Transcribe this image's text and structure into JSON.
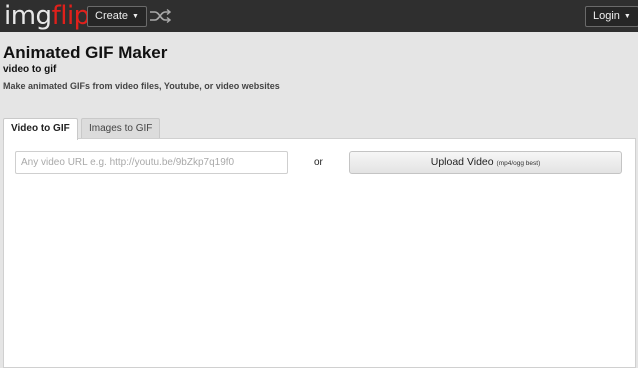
{
  "header": {
    "logo_part1": "img",
    "logo_part2": "flip",
    "create_label": "Create",
    "login_label": "Login",
    "caret": "▼"
  },
  "page": {
    "title": "Animated GIF Maker",
    "subtitle": "video to gif",
    "description": "Make animated GIFs from video files, Youtube, or video websites"
  },
  "tabs": [
    {
      "label": "Video to GIF",
      "active": true
    },
    {
      "label": "Images to GIF",
      "active": false
    }
  ],
  "video": {
    "url_placeholder": "Any video URL e.g. http://youtu.be/9bZkp7q19f0",
    "url_value": "",
    "or_label": "or",
    "upload_label": "Upload Video",
    "upload_note": "(mp4/ogg best)"
  },
  "colors": {
    "brand_red": "#e0201b",
    "topbar": "#2f2f2f"
  }
}
